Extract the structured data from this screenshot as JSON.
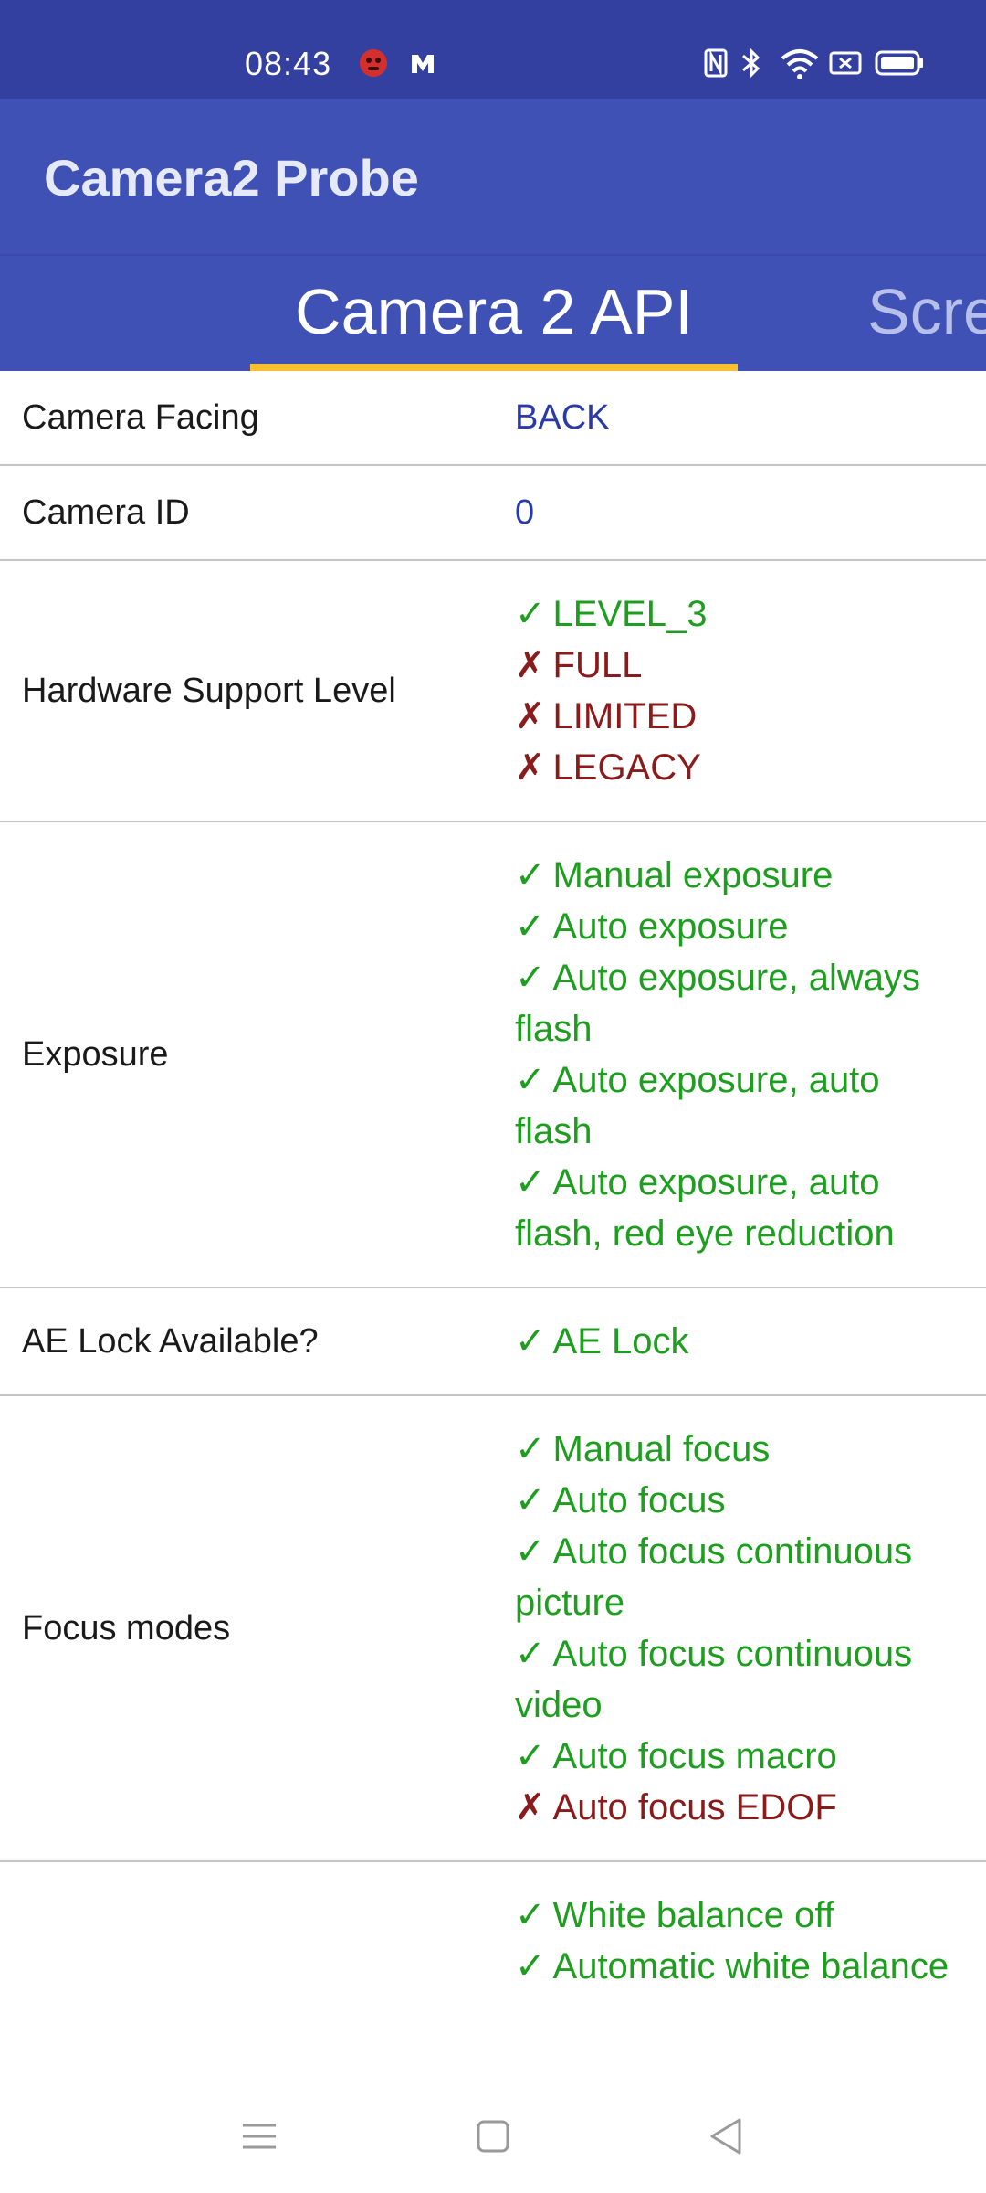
{
  "status_bar": {
    "time": "08:43",
    "notification_icons": [
      "app-notification-icon",
      "messenger-icon"
    ],
    "system_icons": [
      "nfc-icon",
      "bluetooth-icon",
      "wifi-icon",
      "screencast-icon",
      "battery-icon"
    ]
  },
  "app_bar": {
    "title": "Camera2 Probe"
  },
  "tabs": [
    {
      "label": "Camera 2 API",
      "selected": true
    },
    {
      "label": "Scre",
      "selected": false
    }
  ],
  "rows": [
    {
      "label": "Camera Facing",
      "value": "BACK"
    },
    {
      "label": "Camera ID",
      "value": "0"
    },
    {
      "label": "Hardware Support Level",
      "items": [
        {
          "mark": "✓",
          "text": "LEVEL_3",
          "supported": true
        },
        {
          "mark": "✗",
          "text": "FULL",
          "supported": false
        },
        {
          "mark": "✗",
          "text": "LIMITED",
          "supported": false
        },
        {
          "mark": "✗",
          "text": "LEGACY",
          "supported": false
        }
      ]
    },
    {
      "label": "Exposure",
      "items": [
        {
          "mark": "✓",
          "text": "Manual exposure",
          "supported": true
        },
        {
          "mark": "✓",
          "text": "Auto exposure",
          "supported": true
        },
        {
          "mark": "✓",
          "text": "Auto exposure, always flash",
          "supported": true
        },
        {
          "mark": "✓",
          "text": "Auto exposure, auto flash",
          "supported": true
        },
        {
          "mark": "✓",
          "text": "Auto exposure, auto flash, red eye reduction",
          "supported": true
        }
      ]
    },
    {
      "label": "AE Lock Available?",
      "items": [
        {
          "mark": "✓",
          "text": "AE Lock",
          "supported": true
        }
      ]
    },
    {
      "label": "Focus modes",
      "items": [
        {
          "mark": "✓",
          "text": "Manual focus",
          "supported": true
        },
        {
          "mark": "✓",
          "text": "Auto focus",
          "supported": true
        },
        {
          "mark": "✓",
          "text": "Auto focus continuous picture",
          "supported": true
        },
        {
          "mark": "✓",
          "text": "Auto focus continuous video",
          "supported": true
        },
        {
          "mark": "✓",
          "text": "Auto focus macro",
          "supported": true
        },
        {
          "mark": "✗",
          "text": "Auto focus EDOF",
          "supported": false
        }
      ]
    },
    {
      "label": "",
      "items": [
        {
          "mark": "✓",
          "text": "White balance off",
          "supported": true
        },
        {
          "mark": "✓",
          "text": "Automatic white balance",
          "supported": true
        }
      ]
    }
  ],
  "nav_bar": {
    "buttons": [
      "menu-icon",
      "home-icon",
      "back-icon"
    ]
  },
  "colors": {
    "status_bar": "#3340a0",
    "primary": "#3f51b5",
    "tab_indicator": "#fbc02d",
    "supported": "#1e9e1e",
    "unsupported": "#8b1a1a",
    "plain_value": "#2a3aa8"
  }
}
